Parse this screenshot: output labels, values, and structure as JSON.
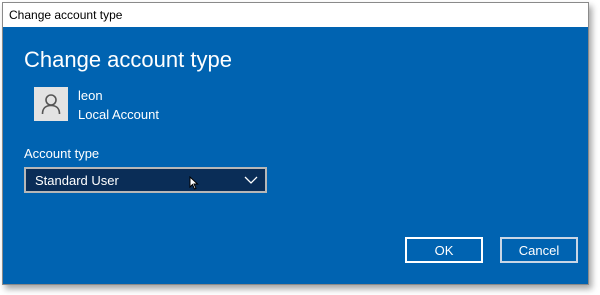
{
  "window": {
    "title": "Change account type"
  },
  "dialog": {
    "heading": "Change account type",
    "user": {
      "name": "leon",
      "account_type": "Local Account",
      "avatar_icon": "person-icon"
    },
    "account_type_field": {
      "label": "Account type",
      "selected": "Standard User"
    },
    "buttons": {
      "ok": "OK",
      "cancel": "Cancel"
    }
  },
  "colors": {
    "dialog_background": "#0063b1",
    "dropdown_background": "#0a2d57",
    "text": "#ffffff"
  }
}
